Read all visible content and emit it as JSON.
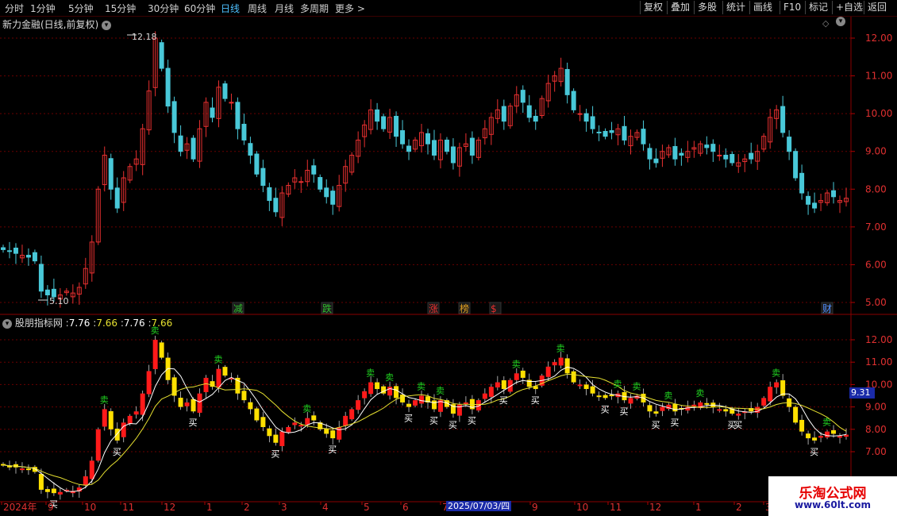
{
  "toolbar": {
    "periods": [
      "分时",
      "1分钟",
      "5分钟",
      "15分钟",
      "30分钟",
      "60分钟",
      "日线",
      "周线",
      "月线",
      "多周期",
      "更多 >"
    ],
    "active_period": "日线",
    "right_buttons": [
      "复权",
      "叠加",
      "多股",
      "统计",
      "画线",
      "F10",
      "标记",
      "+自选",
      "返回"
    ]
  },
  "main_chart": {
    "title": "新力金融(日线,前复权)",
    "high_label": "12.18",
    "low_label": "5.10",
    "y_ticks": [
      "12.00",
      "11.00",
      "10.00",
      "9.00",
      "8.00",
      "7.00",
      "6.00",
      "5.00"
    ],
    "event_tags": [
      {
        "text": "减",
        "color": "#2fbf2f"
      },
      {
        "text": "跌",
        "color": "#2fbf2f"
      },
      {
        "text": "涨",
        "color": "#e83030"
      },
      {
        "text": "榜",
        "color": "#e0a020"
      },
      {
        "text": "$",
        "color": "#e83030"
      },
      {
        "text": "财",
        "color": "#5090ff"
      }
    ]
  },
  "indicator": {
    "name": "股朋指标网",
    "values": [
      "7.76",
      "7.66",
      "7.76",
      "7.66"
    ],
    "y_ticks": [
      "12.00",
      "11.00",
      "10.00",
      "9.00",
      "8.00",
      "7.00"
    ],
    "current_price_tag": "9.31",
    "buy_label": "买",
    "sell_label": "卖"
  },
  "x_axis": {
    "labels": [
      "2024年",
      "9",
      "10",
      "11",
      "12",
      "1",
      "2",
      "3",
      "4",
      "5",
      "6",
      "7",
      "2025/07/03/四",
      "9",
      "10",
      "11",
      "12",
      "1",
      "2",
      "3"
    ]
  },
  "watermark": {
    "name": "乐淘公式网",
    "url": "www.60lt.com"
  },
  "colors": {
    "up": "#e83030",
    "down": "#49c8d8",
    "accent": "#4ec0ff",
    "indicator_up": "#ff1a1a",
    "indicator_down": "#ffe000",
    "signal_sell": "#20d020"
  },
  "chart_data": {
    "type": "candlestick",
    "title": "新力金融(日线,前复权)",
    "ylim": [
      4.9,
      12.4
    ],
    "close_series": [
      6.4,
      6.35,
      6.3,
      6.25,
      6.2,
      6.1,
      5.3,
      5.2,
      5.15,
      5.2,
      5.3,
      5.25,
      5.4,
      5.9,
      6.6,
      8.0,
      8.9,
      8.0,
      7.5,
      8.3,
      8.6,
      8.8,
      9.6,
      10.6,
      12.0,
      11.2,
      10.2,
      9.5,
      9.0,
      9.2,
      8.8,
      9.6,
      10.3,
      9.9,
      10.7,
      10.4,
      10.3,
      9.6,
      9.3,
      8.9,
      8.4,
      8.1,
      7.7,
      7.4,
      7.9,
      8.1,
      8.3,
      8.2,
      8.5,
      8.4,
      8.0,
      7.8,
      7.6,
      8.1,
      8.6,
      8.9,
      9.3,
      9.7,
      10.1,
      9.8,
      9.6,
      9.9,
      9.4,
      9.2,
      9.0,
      9.3,
      9.5,
      9.2,
      8.9,
      9.3,
      9.0,
      8.7,
      9.1,
      9.2,
      8.9,
      9.3,
      9.6,
      9.9,
      10.1,
      9.8,
      10.2,
      10.5,
      10.3,
      9.9,
      9.8,
      10.4,
      10.8,
      11.0,
      11.2,
      10.5,
      10.1,
      10.0,
      9.8,
      9.6,
      9.5,
      9.4,
      9.5,
      9.6,
      9.3,
      9.4,
      9.5,
      9.2,
      8.8,
      8.7,
      9.0,
      9.1,
      8.8,
      8.9,
      9.0,
      9.1,
      9.2,
      9.1,
      9.0,
      8.9,
      8.8,
      8.7,
      8.7,
      8.8,
      8.8,
      9.0,
      9.4,
      9.9,
      10.1,
      9.5,
      9.0,
      8.3,
      7.9,
      7.6,
      7.5,
      7.7,
      7.9,
      7.8,
      7.7,
      7.76
    ]
  }
}
